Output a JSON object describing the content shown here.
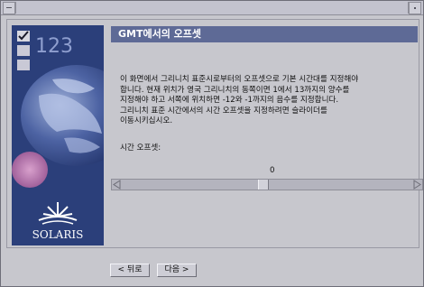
{
  "window": {
    "header_title": "GMT에서의 오프셋"
  },
  "sidebar": {
    "logo_text": "SOLARIS",
    "checklist_number": "123"
  },
  "description_lines": [
    "이 화면에서 그리니치 표준시로부터의 오프셋으로 기본 시간대를 지정해야",
    "합니다. 현재 위치가 영국 그리니치의 동쪽이면 1에서 13까지의 양수를",
    "지정해야 하고 서쪽에 위치하면 -12와 -1까지의 음수를 지정합니다.",
    "그리니치 표준 시간에서의 시간 오프셋을 지정하려면 슬라이더를",
    "이동시키십시오."
  ],
  "offset": {
    "label": "시간 오프셋:",
    "value": "0",
    "slider_min": -12,
    "slider_max": 13,
    "slider_value": 0
  },
  "buttons": {
    "back": "< 뒤로",
    "next": "다음 >"
  },
  "colors": {
    "header_bg": "#5e6a96",
    "sidebar_bg": "#2b3f7a"
  }
}
